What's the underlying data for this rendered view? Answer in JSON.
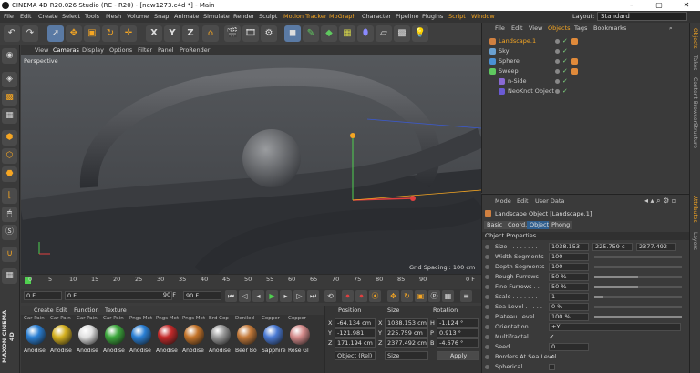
{
  "window": {
    "title": "CINEMA 4D R20.026 Studio (RC - R20) - [new1273.c4d *] - Main",
    "minimize": "–",
    "maximize": "▢",
    "close": "✕"
  },
  "menubar": {
    "items": [
      "File",
      "Edit",
      "Create",
      "Select",
      "Tools",
      "Mesh",
      "Volume",
      "Snap",
      "Animate",
      "Simulate",
      "Render",
      "Sculpt",
      "Motion Tracker",
      "MoGraph",
      "Character",
      "Pipeline",
      "Plugins",
      "Script",
      "Window"
    ],
    "layout_label": "Layout:",
    "layout_value": "Standard"
  },
  "toolbar": {
    "buttons": [
      "undo-icon",
      "redo-icon",
      "live-select-icon",
      "move-icon",
      "scale-icon",
      "rotate-icon",
      "recent-tool-icon",
      "x-axis-icon",
      "y-axis-icon",
      "z-axis-icon",
      "coordinate-system-icon",
      "render-view-icon",
      "render-pictureviewer-icon",
      "render-settings-icon",
      "cube-icon",
      "pen-icon",
      "subdivision-icon",
      "array-icon",
      "deformer-icon",
      "floor-icon",
      "camera-icon",
      "light-icon"
    ],
    "axis_labels": {
      "x": "X",
      "y": "Y",
      "z": "Z"
    }
  },
  "viewport": {
    "menu": [
      "View",
      "Cameras",
      "Display",
      "Options",
      "Filter",
      "Panel",
      "ProRender"
    ],
    "label": "Perspective",
    "grid_spacing": "Grid Spacing : 100 cm"
  },
  "timeline": {
    "ticks": [
      "0",
      "5",
      "10",
      "15",
      "20",
      "25",
      "30",
      "35",
      "40",
      "45",
      "50",
      "55",
      "60",
      "65",
      "70",
      "75",
      "80",
      "85",
      "90"
    ],
    "end_label": "0 F"
  },
  "transport": {
    "start": "0 F",
    "current": "0 F",
    "end1": "90 F",
    "end2": "90 F"
  },
  "materials": {
    "menu": [
      "Create",
      "Edit",
      "Function",
      "Texture"
    ],
    "captions": [
      "Car Pain",
      "Car Pain",
      "Car Pain",
      "Car Pain",
      "Pngs Met",
      "Pngs Met",
      "Pngs Met",
      "Brd Cop",
      "Deniled",
      "Copper",
      "Copper"
    ],
    "labels": [
      "Anodise",
      "Anodise",
      "Anodise",
      "Anodise",
      "Anodise",
      "Anodise",
      "Anodise",
      "Anodise",
      "Beer Bo",
      "Sapphire",
      "Rose Gl"
    ],
    "colors": [
      "#2a7fd4",
      "#d4b020",
      "#e0e0e0",
      "#3ca83c",
      "#2a7fd4",
      "#c42a2a",
      "#c4742a",
      "#9a9a9a",
      "#c47a3a",
      "#4a7ad4",
      "#d48a8a"
    ],
    "brand_top": "MAXON",
    "brand_bottom": "CINEMA 4D"
  },
  "coordinates": {
    "headers": [
      "Position",
      "Size",
      "Rotation"
    ],
    "rows": [
      {
        "axis": "X",
        "pos": "-64.134 cm",
        "size_axis": "X",
        "size": "1038.153 cm",
        "rot_axis": "H",
        "rot": "-1.124 °"
      },
      {
        "axis": "Y",
        "pos": "-121.981 cm",
        "size_axis": "Y",
        "size": "225.759 cm",
        "rot_axis": "P",
        "rot": "0.913 °"
      },
      {
        "axis": "Z",
        "pos": "171.194 cm",
        "size_axis": "Z",
        "size": "2377.492 cm",
        "rot_axis": "B",
        "rot": "-4.676 °"
      }
    ],
    "mode": "Object (Rel)",
    "size_mode": "Size",
    "apply": "Apply"
  },
  "objects": {
    "menu": [
      "File",
      "Edit",
      "View",
      "Objects",
      "Tags",
      "Bookmarks"
    ],
    "active_tab": "Objects",
    "items": [
      {
        "name": "Landscape.1",
        "color": "#f5a623",
        "indent": 0
      },
      {
        "name": "Sky",
        "color": "#c8c8c8",
        "indent": 0
      },
      {
        "name": "Sphere",
        "color": "#c8c8c8",
        "indent": 0
      },
      {
        "name": "Sweep",
        "color": "#c8c8c8",
        "indent": 0
      },
      {
        "name": "n-Side",
        "color": "#c8c8c8",
        "indent": 1
      },
      {
        "name": "NeoKnot Object",
        "color": "#c8c8c8",
        "indent": 1
      }
    ]
  },
  "attributes": {
    "menu": [
      "Mode",
      "Edit",
      "User Data"
    ],
    "header": "Landscape Object [Landscape.1]",
    "tabs": [
      "Basic",
      "Coord.",
      "Object",
      "Phong"
    ],
    "active_tab": "Object",
    "section": "Object Properties",
    "rows": [
      {
        "label": "Size . . . . . . . .",
        "value": "1038.153",
        "v2": "225.759 c",
        "v3": "2377.492"
      },
      {
        "label": "Width Segments",
        "value": "100",
        "fill": 0.0
      },
      {
        "label": "Depth Segments",
        "value": "100",
        "fill": 0.0
      },
      {
        "label": "Rough Furrows",
        "value": "50 %",
        "fill": 0.5
      },
      {
        "label": "Fine Furrows . .",
        "value": "50 %",
        "fill": 0.5
      },
      {
        "label": "Scale . . . . . . . .",
        "value": "1",
        "fill": 0.1
      },
      {
        "label": "Sea Level . . . . .",
        "value": "0 %",
        "fill": 0.0
      },
      {
        "label": "Plateau Level",
        "value": "100 %",
        "fill": 1.0
      },
      {
        "label": "Orientation . . . .",
        "value": "+Y",
        "fill": null
      },
      {
        "label": "Multifractal . . . .",
        "value": "✓",
        "fill": null
      },
      {
        "label": "Seed . . . . . . . .",
        "value": "0",
        "fill": null
      },
      {
        "label": "Borders At Sea Level",
        "value": "✓",
        "fill": null
      },
      {
        "label": "Spherical . . . . .",
        "value": "",
        "fill": null
      }
    ]
  },
  "side_tabs": [
    "Objects",
    "Takes",
    "Content Browser",
    "Structure",
    "Attributes",
    "Layers"
  ]
}
